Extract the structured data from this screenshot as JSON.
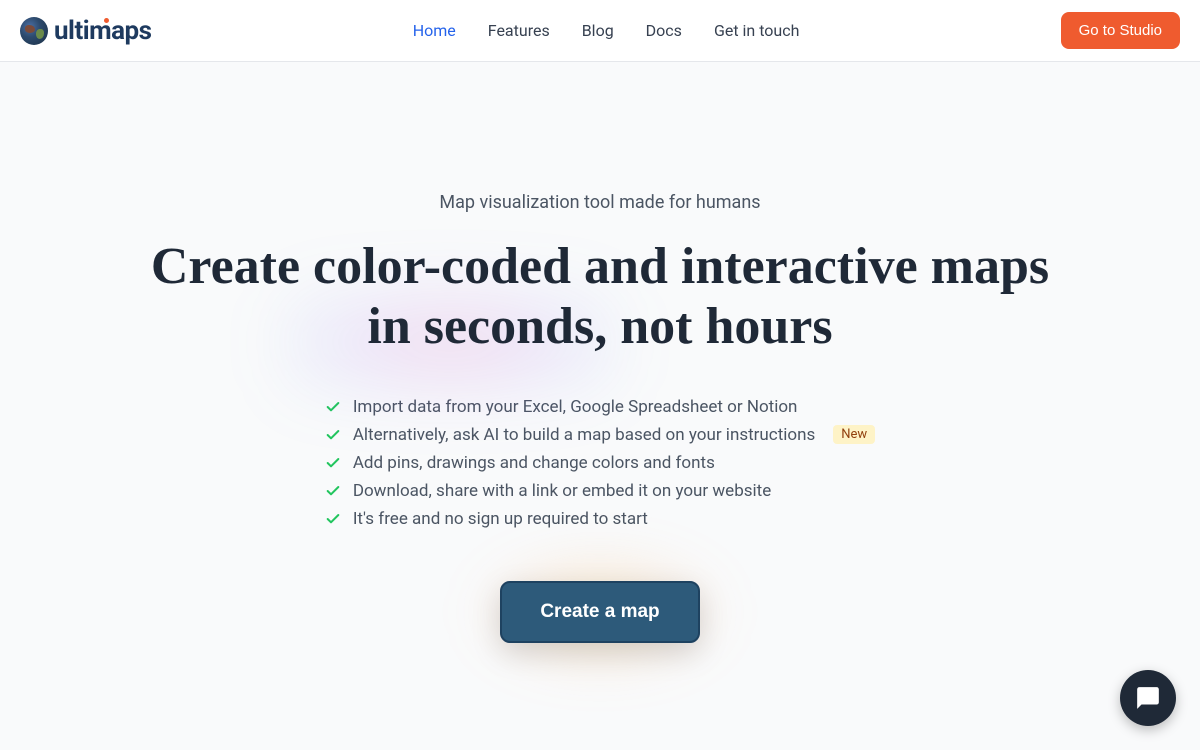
{
  "brand": "ultimaps",
  "nav": {
    "items": [
      {
        "label": "Home",
        "active": true
      },
      {
        "label": "Features",
        "active": false
      },
      {
        "label": "Blog",
        "active": false
      },
      {
        "label": "Docs",
        "active": false
      },
      {
        "label": "Get in touch",
        "active": false
      }
    ],
    "cta": "Go to Studio"
  },
  "hero": {
    "tagline": "Map visualization tool made for humans",
    "headline_l1": "Create color-coded and interactive maps",
    "headline_l2": "in seconds, not hours",
    "features": [
      {
        "text": "Import data from your Excel, Google Spreadsheet or Notion",
        "badge": null
      },
      {
        "text": "Alternatively, ask AI to build a map based on your instructions",
        "badge": "New"
      },
      {
        "text": "Add pins, drawings and change colors and fonts",
        "badge": null
      },
      {
        "text": "Download, share with a link or embed it on your website",
        "badge": null
      },
      {
        "text": "It's free and no sign up required to start",
        "badge": null
      }
    ],
    "cta": "Create a map"
  }
}
